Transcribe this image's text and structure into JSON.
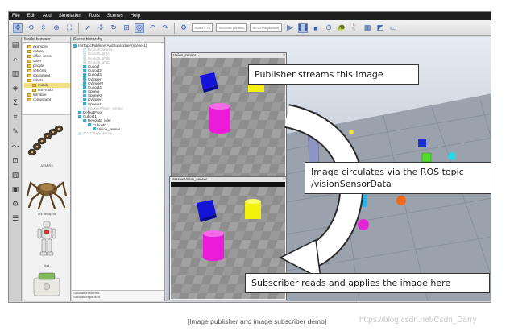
{
  "menubar": {
    "items": [
      "File",
      "Edit",
      "Add",
      "Simulation",
      "Tools",
      "Scenes",
      "Help"
    ]
  },
  "toolbar": {
    "combo_left": "Bullet 2.78",
    "combo_right": "Accurate (default)",
    "combo_speed": "dt=50 ms (default)"
  },
  "model_browser": {
    "title": "Model browser",
    "tree": [
      {
        "label": "examples",
        "highlight": false
      },
      {
        "label": "nature",
        "highlight": false
      },
      {
        "label": "office items",
        "highlight": false
      },
      {
        "label": "other",
        "highlight": false
      },
      {
        "label": "people",
        "highlight": false
      },
      {
        "label": "vehicles",
        "highlight": false
      },
      {
        "label": "equipment",
        "highlight": false
      },
      {
        "label": "robots",
        "highlight": false
      },
      {
        "label": "mobile",
        "highlight": true
      },
      {
        "label": "non-mobi",
        "highlight": false
      },
      {
        "label": "furniture",
        "highlight": false
      },
      {
        "label": "component",
        "highlight": false
      }
    ],
    "models": [
      "ACM-R5",
      "ant hexapod",
      "Asti"
    ]
  },
  "scene_hierarchy": {
    "title": "Scene hierarchy",
    "rows": [
      {
        "label": "rosTopicPublisherAndSubscriber (scene 1)",
        "indent": 0,
        "dim": false,
        "icon": "scene"
      },
      {
        "label": "DefaultCamera",
        "indent": 2,
        "dim": true,
        "icon": "camera"
      },
      {
        "label": "DefaultLightA",
        "indent": 2,
        "dim": true,
        "icon": "light"
      },
      {
        "label": "DefaultLightB",
        "indent": 2,
        "dim": true,
        "icon": "light"
      },
      {
        "label": "DefaultLightC",
        "indent": 2,
        "dim": true,
        "icon": "light"
      },
      {
        "label": "Cuboid",
        "indent": 2,
        "dim": false,
        "icon": "shape"
      },
      {
        "label": "Cuboid2",
        "indent": 2,
        "dim": false,
        "icon": "shape"
      },
      {
        "label": "Cuboid3",
        "indent": 2,
        "dim": false,
        "icon": "shape"
      },
      {
        "label": "Cylinder",
        "indent": 2,
        "dim": false,
        "icon": "shape"
      },
      {
        "label": "Cylinder0",
        "indent": 2,
        "dim": false,
        "icon": "shape"
      },
      {
        "label": "Cuboid4",
        "indent": 2,
        "dim": false,
        "icon": "shape"
      },
      {
        "label": "Sphere",
        "indent": 2,
        "dim": false,
        "icon": "shape"
      },
      {
        "label": "Sphere0",
        "indent": 2,
        "dim": false,
        "icon": "shape"
      },
      {
        "label": "Cylinder1",
        "indent": 2,
        "dim": false,
        "icon": "shape"
      },
      {
        "label": "Sphere1",
        "indent": 2,
        "dim": false,
        "icon": "shape"
      },
      {
        "label": "PassiveVision_sensor",
        "indent": 2,
        "dim": true,
        "icon": "sensor"
      },
      {
        "label": "DefaultFloor",
        "indent": 1,
        "dim": false,
        "icon": "shape"
      },
      {
        "label": "Cuboid1",
        "indent": 1,
        "dim": false,
        "icon": "shape"
      },
      {
        "label": "Revolute_joint",
        "indent": 2,
        "dim": false,
        "icon": "joint"
      },
      {
        "label": "Cuboid0",
        "indent": 3,
        "dim": false,
        "icon": "shape"
      },
      {
        "label": "Vision_sensor",
        "indent": 4,
        "dim": false,
        "icon": "sensor"
      },
      {
        "label": "XYZCameraProxy",
        "indent": 1,
        "dim": true,
        "icon": "camera"
      }
    ],
    "console": [
      "Simulation started.",
      "Simulation paused."
    ]
  },
  "vision_windows": {
    "top_title": "Vision_sensor",
    "bottom_title": "PassiveVision_sensor"
  },
  "callouts": {
    "publisher": "Publisher streams this image",
    "topic_line1": "Image circulates via the ROS topic",
    "topic_line2": "/visionSensorData",
    "subscriber": "Subscriber reads and applies the image here"
  },
  "caption": "[Image publisher and image subscriber demo]",
  "watermark": "https://blog.csdn.net/Csdn_Darry",
  "colors": {
    "cube_blue": "#1414d8",
    "cylinder_yellow": "#f2f20c",
    "cylinder_magenta": "#ec1ad9"
  }
}
